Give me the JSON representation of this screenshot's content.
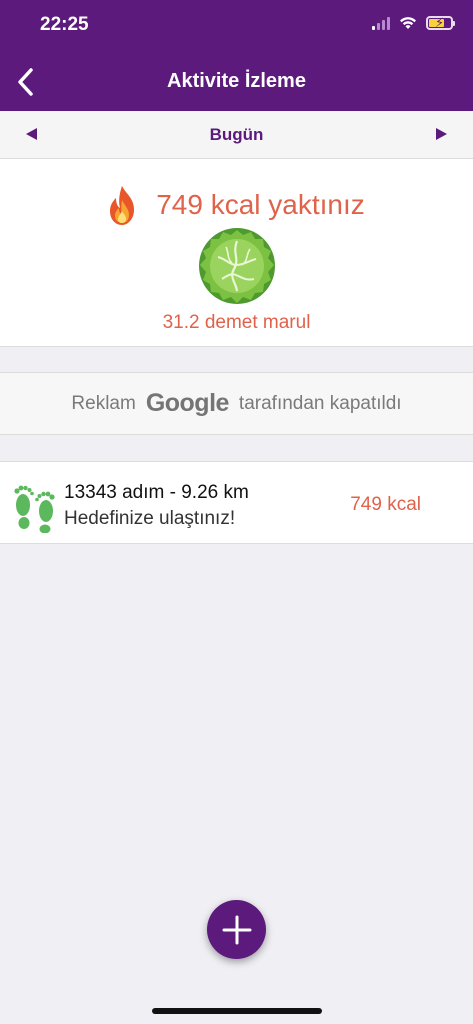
{
  "status_bar": {
    "time": "22:25",
    "battery_level": 0.72
  },
  "nav": {
    "title": "Aktivite İzleme",
    "back_icon": "chevron-left-icon"
  },
  "date_selector": {
    "label": "Bugün",
    "prev_icon": "triangle-left-icon",
    "next_icon": "triangle-right-icon"
  },
  "summary": {
    "burned_text": "749 kcal yaktınız",
    "equivalent_text": "31.2 demet marul",
    "icons": [
      "fire-icon",
      "lettuce-icon"
    ]
  },
  "ad": {
    "prefix": "Reklam",
    "brand": "Google",
    "suffix": "tarafından kapatıldı"
  },
  "activities": [
    {
      "icon": "footprints-icon",
      "title": "13343 adım - 9.26 km",
      "subtitle": "Hedefinize ulaştınız!",
      "kcal": "749 kcal"
    }
  ],
  "fab": {
    "icon": "plus-icon"
  },
  "colors": {
    "primary": "#5b1a7c",
    "accent": "#e0624a",
    "background": "#efeff4",
    "feet_green": "#5cb85c"
  }
}
